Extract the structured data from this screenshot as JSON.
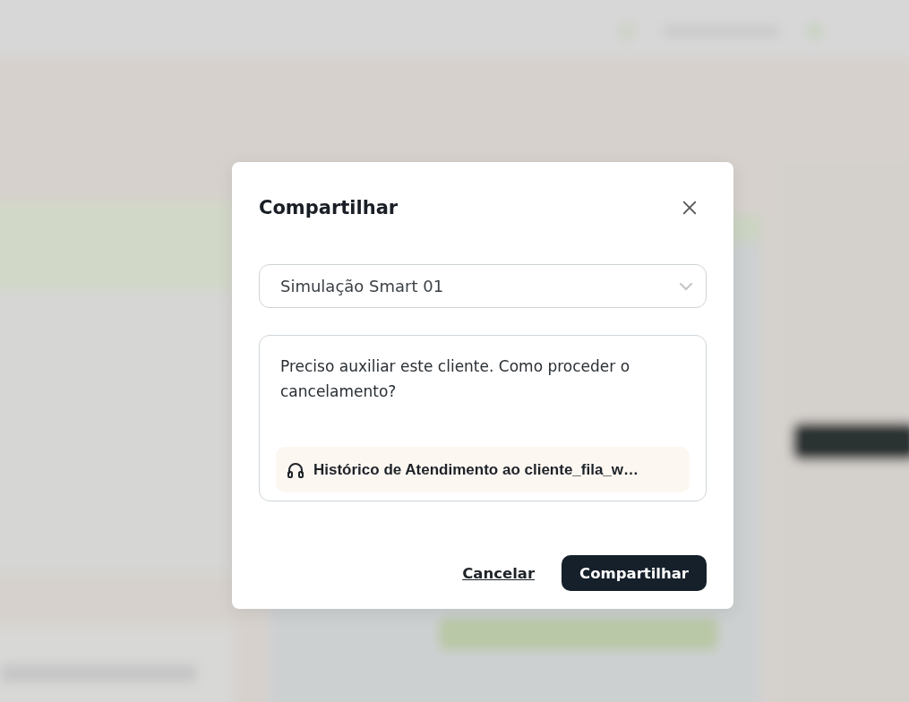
{
  "dialog": {
    "title": "Compartilhar",
    "select": {
      "value": "Simulação Smart 01"
    },
    "message": {
      "value": "Preciso auxiliar este cliente. Como proceder o cancelamento?"
    },
    "attachment": {
      "label": "Histórico de Atendimento ao cliente_fila_w…"
    },
    "buttons": [
      {
        "label": "Cancelar",
        "kind": "link"
      },
      {
        "label": "Compartilhar",
        "kind": "primary"
      }
    ]
  }
}
